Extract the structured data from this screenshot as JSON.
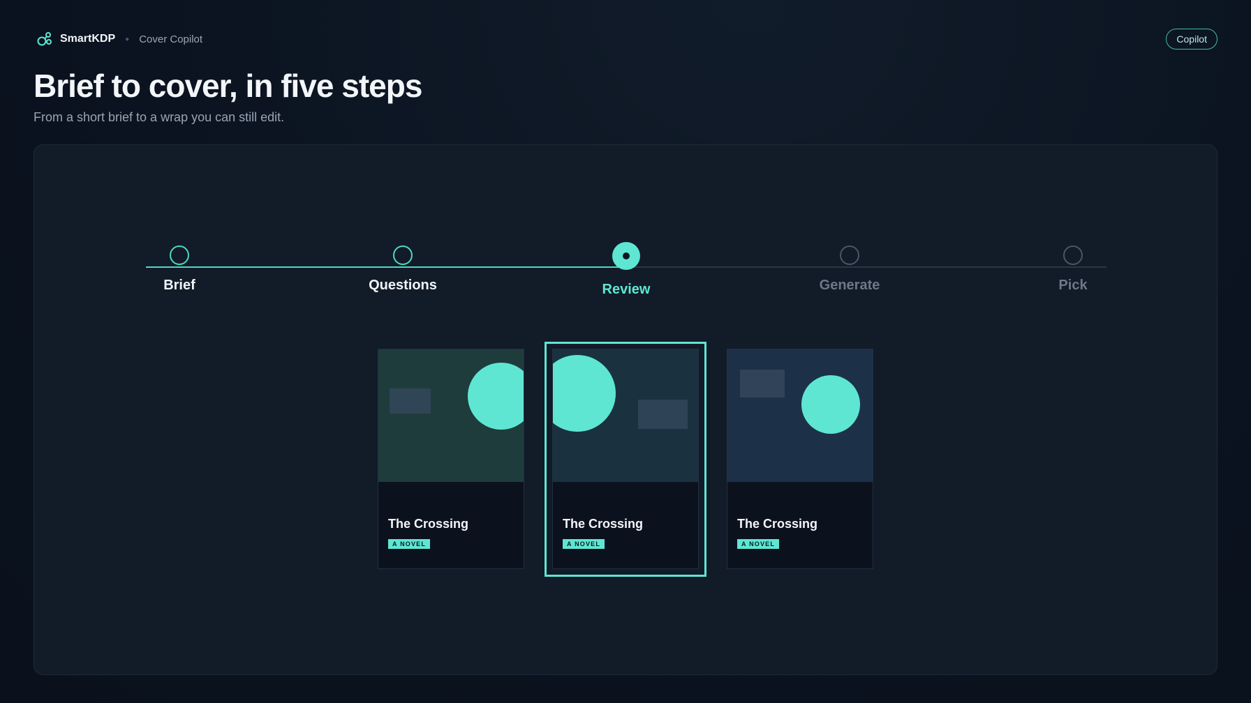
{
  "header": {
    "brand": "SmartKDP",
    "product": "Cover Copilot",
    "copilot_button": "Copilot"
  },
  "page": {
    "title": "Brief to cover, in five steps",
    "subtitle": "From a short brief to a wrap you can still edit."
  },
  "stepper": {
    "current_step": 3,
    "steps": [
      {
        "label": "Brief",
        "state": "done"
      },
      {
        "label": "Questions",
        "state": "done"
      },
      {
        "label": "Review",
        "state": "active"
      },
      {
        "label": "Generate",
        "state": "todo"
      },
      {
        "label": "Pick",
        "state": "todo"
      }
    ]
  },
  "covers": {
    "selected_index": 1,
    "items": [
      {
        "title": "The Crossing",
        "badge": "A NOVEL",
        "art_color": "#1e3c3b"
      },
      {
        "title": "The Crossing",
        "badge": "A NOVEL",
        "art_color": "#1a3240"
      },
      {
        "title": "The Crossing",
        "badge": "A NOVEL",
        "art_color": "#1c3148"
      }
    ]
  },
  "colors": {
    "accent": "#5ee6d3",
    "background": "#0b1320",
    "panel": "#121b28"
  }
}
